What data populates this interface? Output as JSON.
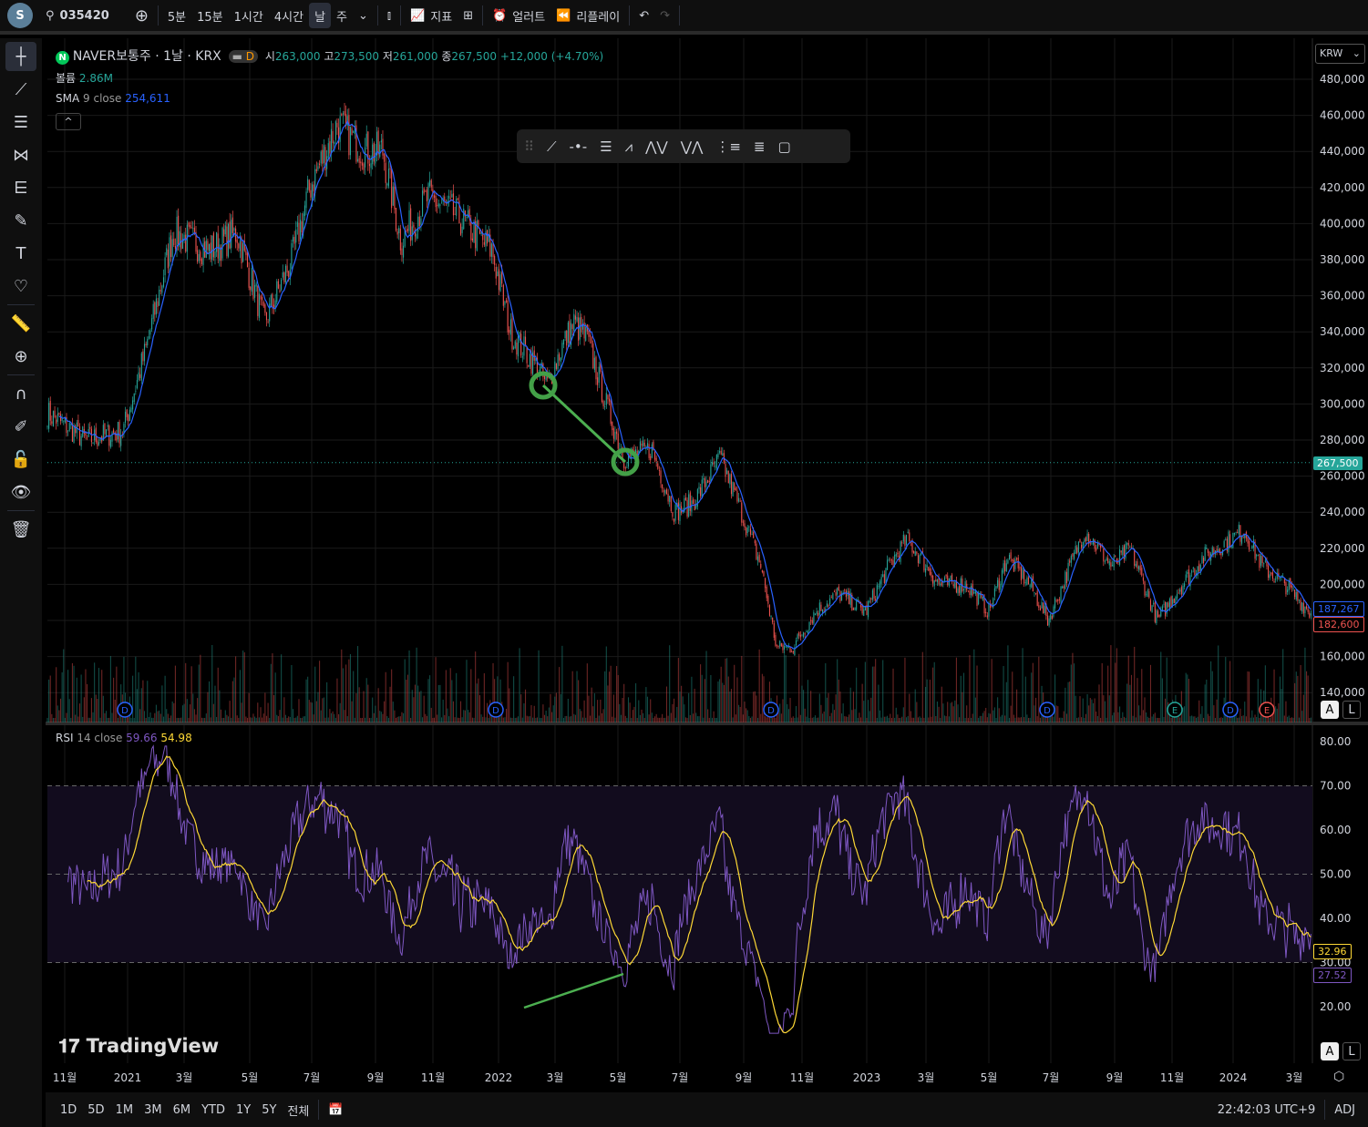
{
  "topbar": {
    "symbol": "035420",
    "intervals": [
      "5분",
      "15분",
      "1시간",
      "4시간",
      "날",
      "주"
    ],
    "selected_interval": "날",
    "indicators_label": "지표",
    "alert_label": "얼러트",
    "replay_label": "리플레이",
    "logo_letter": "S"
  },
  "legend": {
    "title": "NAVER보통주 · 1날 · KRX",
    "badge": "D",
    "open_label": "시",
    "open": "263,000",
    "high_label": "고",
    "high": "273,500",
    "low_label": "저",
    "low": "261,000",
    "close_label": "종",
    "close": "267,500",
    "change": "+12,000 (+4.70%)",
    "volume_label": "볼륨",
    "volume": "2.86M",
    "sma_label": "SMA",
    "sma_params": "9 close",
    "sma_value": "254,611",
    "rsi_label": "RSI",
    "rsi_params": "14 close",
    "rsi_value": "59.66",
    "rsi_ma_value": "54.98"
  },
  "currency": "KRW",
  "price_axis": [
    "480,000",
    "460,000",
    "440,000",
    "420,000",
    "400,000",
    "380,000",
    "360,000",
    "340,000",
    "320,000",
    "300,000",
    "280,000",
    "260,000",
    "240,000",
    "220,000",
    "200,000",
    "180,000",
    "160,000",
    "140,000"
  ],
  "price_tags": {
    "last": "267,500",
    "sma": "187,267",
    "low": "182,600"
  },
  "rsi_axis": [
    "80.00",
    "70.00",
    "60.00",
    "50.00",
    "40.00",
    "30.00",
    "20.00"
  ],
  "rsi_tags": {
    "ma": "32.96",
    "rsi": "27.52"
  },
  "time_axis": [
    "11월",
    "2021",
    "3월",
    "5월",
    "7월",
    "9월",
    "11월",
    "2022",
    "3월",
    "5월",
    "7월",
    "9월",
    "11월",
    "2023",
    "3월",
    "5월",
    "7월",
    "9월",
    "11월",
    "2024",
    "3월"
  ],
  "events": [
    "D",
    "D",
    "D",
    "D",
    "E",
    "D",
    "E"
  ],
  "watermark": "TradingView",
  "bottombar": {
    "ranges": [
      "1D",
      "5D",
      "1M",
      "3M",
      "6M",
      "YTD",
      "1Y",
      "5Y",
      "전체"
    ],
    "time": "22:42:03 UTC+9",
    "adj": "ADJ"
  },
  "scale_buttons": {
    "auto": "A",
    "log": "L"
  },
  "colors": {
    "up": "#26a69a",
    "down": "#ef5350",
    "sma": "#2962ff",
    "rsi": "#7e57c2",
    "rsi_ma": "#fdd835",
    "annotation": "#4caf50"
  },
  "chart_data": {
    "type": "candlestick",
    "approx_close_path": [
      295,
      280,
      285,
      330,
      395,
      385,
      395,
      345,
      380,
      420,
      455,
      440,
      440,
      390,
      415,
      405,
      385,
      340,
      320,
      310,
      330,
      345,
      335,
      300,
      270,
      275,
      240,
      245,
      270,
      245,
      210,
      165,
      165,
      185,
      195,
      185,
      210,
      225,
      215,
      200,
      200,
      185,
      215,
      200,
      180,
      205,
      230,
      210,
      220,
      180,
      195,
      215,
      230,
      210,
      200,
      183
    ],
    "price_unit": "thousand KRW",
    "rsi_levels": [
      70,
      50,
      30
    ]
  }
}
